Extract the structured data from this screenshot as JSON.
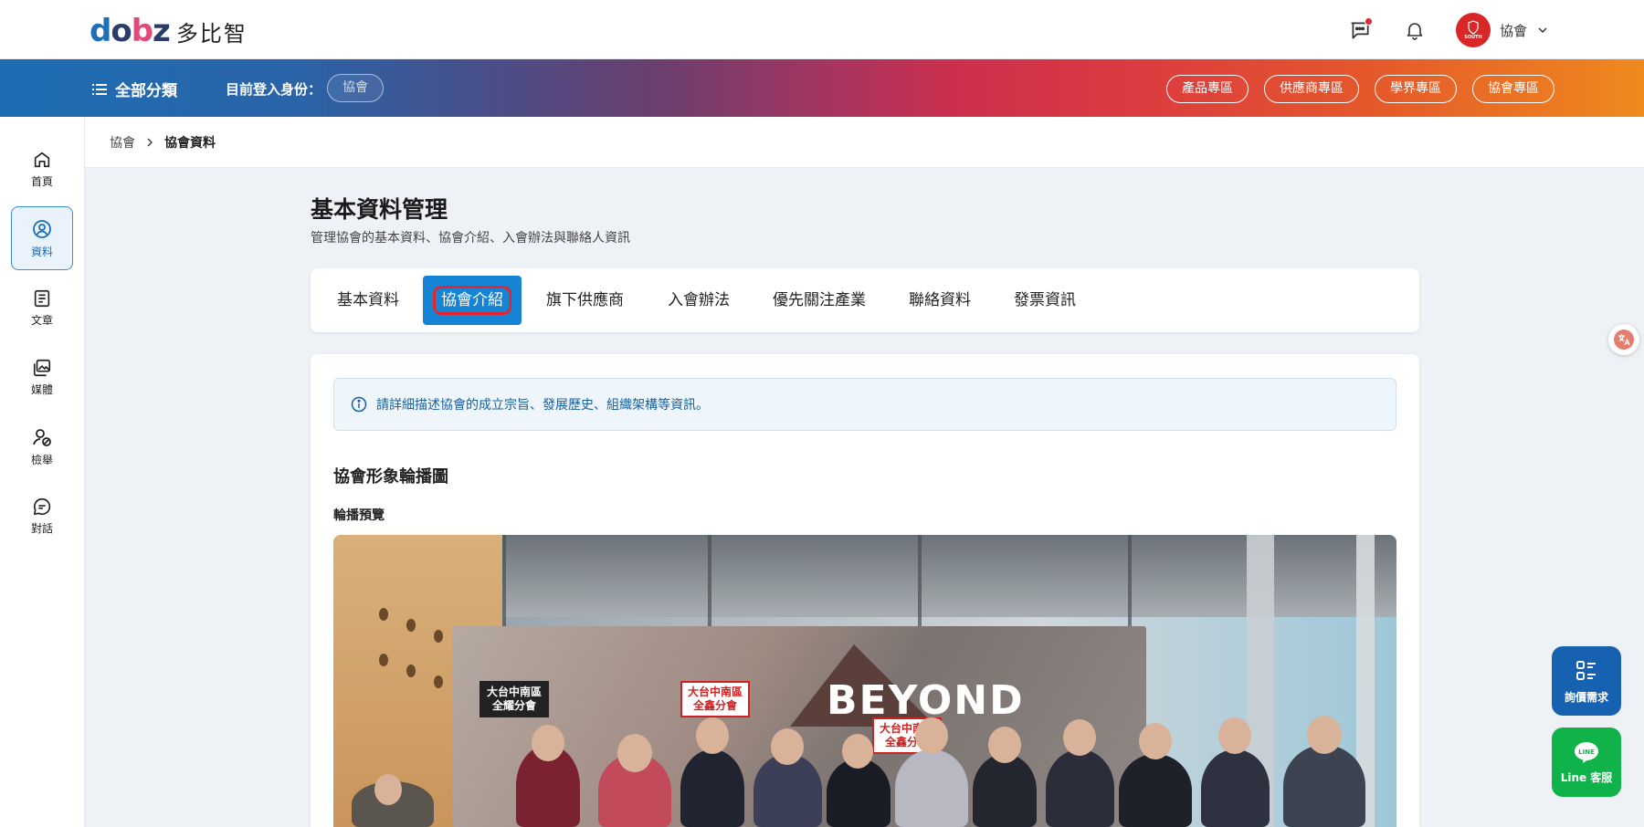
{
  "brand": {
    "logo_text": "多比智"
  },
  "header": {
    "user_name": "協會",
    "avatar_label": "SOUTH"
  },
  "topnav": {
    "category_label": "全部分類",
    "login_label": "目前登入身份：",
    "login_role": "協會",
    "zones": [
      "產品專區",
      "供應商專區",
      "學界專區",
      "協會專區"
    ]
  },
  "sidebar": {
    "items": [
      {
        "label": "首頁",
        "icon": "home-icon"
      },
      {
        "label": "資料",
        "icon": "user-circle-icon",
        "active": true
      },
      {
        "label": "文章",
        "icon": "document-icon"
      },
      {
        "label": "媒體",
        "icon": "media-icon"
      },
      {
        "label": "檢舉",
        "icon": "report-user-icon"
      },
      {
        "label": "對話",
        "icon": "chat-icon"
      }
    ]
  },
  "breadcrumb": {
    "parent": "協會",
    "current": "協會資料"
  },
  "page": {
    "title": "基本資料管理",
    "subtitle": "管理協會的基本資料、協會介紹、入會辦法與聯絡人資訊"
  },
  "tabs": [
    "基本資料",
    "協會介紹",
    "旗下供應商",
    "入會辦法",
    "優先關注產業",
    "聯絡資料",
    "發票資訊"
  ],
  "active_tab": "協會介紹",
  "content": {
    "info_text": "請詳細描述協會的成立宗旨、發展歷史、組織架構等資訊。",
    "section_title": "協會形象輪播圖",
    "section_sub": "輪播預覽",
    "photo": {
      "backdrop_text": "BEYOND",
      "signs": [
        "大台中南區\n全耀分會",
        "大台中南區\n全鑫分會",
        "大台中南區\n全鑫分會"
      ]
    }
  },
  "floating": {
    "inquiry_label": "詢價需求",
    "line_label": "Line 客服",
    "line_badge": "LINE"
  },
  "colors": {
    "primary": "#1584d4",
    "highlight_ring": "#e3262f",
    "line_green": "#10b24a",
    "inquiry_blue": "#1661b0"
  }
}
